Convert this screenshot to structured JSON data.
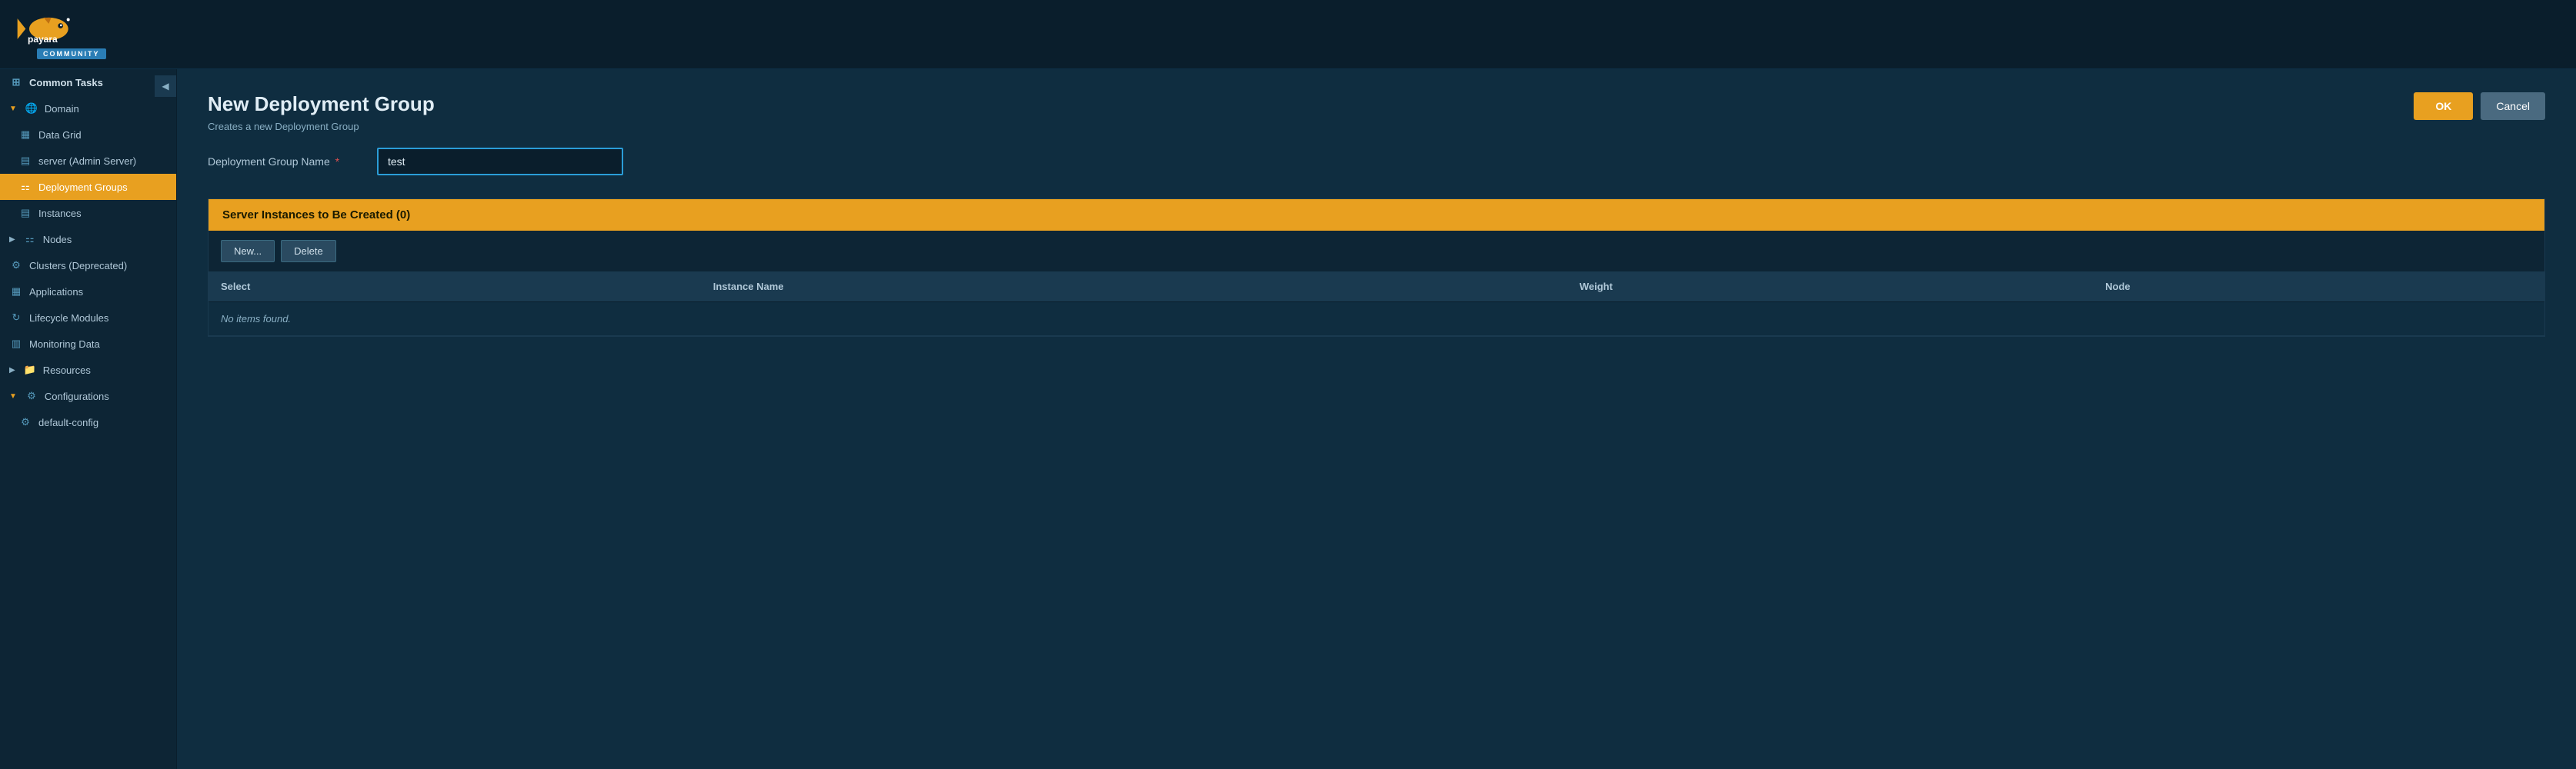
{
  "header": {
    "logo_alt": "Payara",
    "community_label": "COMMUNITY"
  },
  "sidebar": {
    "collapse_button_label": "◀",
    "items": [
      {
        "id": "common-tasks",
        "label": "Common Tasks",
        "indent": 0,
        "icon": "grid",
        "active": false,
        "arrow": ""
      },
      {
        "id": "domain",
        "label": "Domain",
        "indent": 0,
        "icon": "globe",
        "active": false,
        "arrow": "▼"
      },
      {
        "id": "data-grid",
        "label": "Data Grid",
        "indent": 1,
        "icon": "grid",
        "active": false,
        "arrow": ""
      },
      {
        "id": "server",
        "label": "server (Admin Server)",
        "indent": 1,
        "icon": "server",
        "active": false,
        "arrow": ""
      },
      {
        "id": "deployment-groups",
        "label": "Deployment Groups",
        "indent": 1,
        "icon": "nodes",
        "active": true,
        "arrow": ""
      },
      {
        "id": "instances",
        "label": "Instances",
        "indent": 1,
        "icon": "instance",
        "active": false,
        "arrow": ""
      },
      {
        "id": "nodes",
        "label": "Nodes",
        "indent": 0,
        "icon": "node",
        "active": false,
        "arrow": "▶"
      },
      {
        "id": "clusters",
        "label": "Clusters (Deprecated)",
        "indent": 0,
        "icon": "cluster",
        "active": false,
        "arrow": ""
      },
      {
        "id": "applications",
        "label": "Applications",
        "indent": 0,
        "icon": "app",
        "active": false,
        "arrow": ""
      },
      {
        "id": "lifecycle-modules",
        "label": "Lifecycle Modules",
        "indent": 0,
        "icon": "lifecycle",
        "active": false,
        "arrow": ""
      },
      {
        "id": "monitoring-data",
        "label": "Monitoring Data",
        "indent": 0,
        "icon": "monitor",
        "active": false,
        "arrow": ""
      },
      {
        "id": "resources",
        "label": "Resources",
        "indent": 0,
        "icon": "resource",
        "active": false,
        "arrow": "▶"
      },
      {
        "id": "configurations",
        "label": "Configurations",
        "indent": 0,
        "icon": "config",
        "active": false,
        "arrow": "▼"
      },
      {
        "id": "default-config",
        "label": "default-config",
        "indent": 1,
        "icon": "config-item",
        "active": false,
        "arrow": ""
      }
    ]
  },
  "page": {
    "title": "New Deployment Group",
    "subtitle": "Creates a new Deployment Group",
    "ok_button": "OK",
    "cancel_button": "Cancel"
  },
  "form": {
    "group_name_label": "Deployment Group Name",
    "group_name_value": "test",
    "group_name_placeholder": ""
  },
  "table_section": {
    "header": "Server Instances to Be Created (0)",
    "new_button": "New...",
    "delete_button": "Delete",
    "columns": [
      "Select",
      "Instance Name",
      "Weight",
      "Node"
    ],
    "empty_message": "No items found."
  }
}
